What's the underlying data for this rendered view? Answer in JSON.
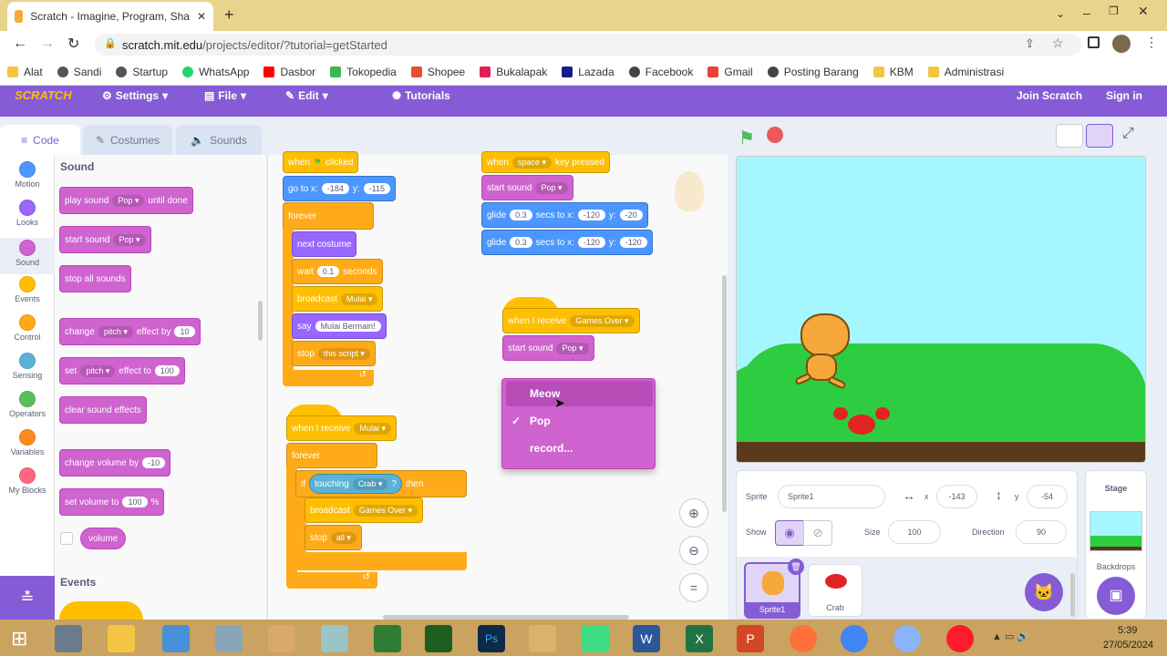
{
  "browser": {
    "tab_title": "Scratch - Imagine, Program, Sha",
    "url_domain": "scratch.mit.edu",
    "url_path": "/projects/editor/?tutorial=getStarted",
    "bookmarks": [
      "Alat",
      "Sandi",
      "Startup",
      "WhatsApp",
      "Dasbor",
      "Tokopedia",
      "Shopee",
      "Bukalapak",
      "Lazada",
      "Facebook",
      "Gmail",
      "Posting Barang",
      "KBM",
      "Administrasi"
    ]
  },
  "menubar": {
    "logo": "SCRATCH",
    "settings": "Settings",
    "file": "File",
    "edit": "Edit",
    "tutorials": "Tutorials",
    "join": "Join Scratch",
    "signin": "Sign in"
  },
  "tabs": {
    "code": "Code",
    "costumes": "Costumes",
    "sounds": "Sounds"
  },
  "categories": [
    {
      "label": "Motion",
      "color": "#4c97ff"
    },
    {
      "label": "Looks",
      "color": "#9966ff"
    },
    {
      "label": "Sound",
      "color": "#cf63cf"
    },
    {
      "label": "Events",
      "color": "#ffbf00"
    },
    {
      "label": "Control",
      "color": "#ffab19"
    },
    {
      "label": "Sensing",
      "color": "#5cb1d6"
    },
    {
      "label": "Operators",
      "color": "#59c059"
    },
    {
      "label": "Variables",
      "color": "#ff8c1a"
    },
    {
      "label": "My Blocks",
      "color": "#ff6680"
    }
  ],
  "palette": {
    "heading": "Sound",
    "play_sound": "play sound",
    "pop": "Pop",
    "until_done": "until done",
    "start_sound": "start sound",
    "stop_all": "stop all sounds",
    "change": "change",
    "pitch": "pitch",
    "effect_by": "effect by",
    "val10": "10",
    "set": "set",
    "effect_to": "effect to",
    "val100": "100",
    "clear_effects": "clear sound effects",
    "change_volume": "change volume by",
    "val_neg10": "-10",
    "set_volume": "set volume to",
    "percent": "%",
    "volume": "volume",
    "events_heading": "Events"
  },
  "script1": {
    "when": "when",
    "clicked": "clicked",
    "goto": "go to x:",
    "x": "-184",
    "y_label": "y:",
    "y": "-115",
    "forever": "forever",
    "next_costume": "next costume",
    "wait": "wait",
    "wait_val": "0.1",
    "seconds": "seconds",
    "broadcast": "broadcast",
    "mulai": "Mulai",
    "say": "say",
    "say_text": "Mulai Bermain!",
    "stop": "stop",
    "this_script": "this script"
  },
  "script2": {
    "when": "when",
    "key": "space",
    "key_pressed": "key pressed",
    "start_sound": "start sound",
    "pop": "Pop",
    "glide": "glide",
    "secs": "0.3",
    "secs_to_x": "secs to x:",
    "x1": "-120",
    "y_label": "y:",
    "y1": "-20",
    "x2": "-120",
    "y2": "-120"
  },
  "script3": {
    "when_receive": "when I receive",
    "message": "Games Over",
    "start_sound": "start sound",
    "pop": "Pop"
  },
  "dropdown": {
    "items": [
      "Meow",
      "Pop",
      "record..."
    ],
    "checkmark": "✓"
  },
  "script4": {
    "when_receive": "when I receive",
    "message": "Mulai",
    "forever": "forever",
    "if": "if",
    "touching": "touching",
    "crab": "Crab",
    "q": "?",
    "then": "then",
    "broadcast": "broadcast",
    "games_over": "Games Over",
    "stop": "stop",
    "all": "all"
  },
  "zoom": {
    "reset": "="
  },
  "sprite_info": {
    "sprite_label": "Sprite",
    "sprite_name": "Sprite1",
    "x_label": "x",
    "x": "-143",
    "y_label": "y",
    "y": "-54",
    "show_label": "Show",
    "size_label": "Size",
    "size": "100",
    "direction_label": "Direction",
    "direction": "90"
  },
  "sprites": [
    {
      "name": "Sprite1"
    },
    {
      "name": "Crab"
    }
  ],
  "stage_panel": {
    "title": "Stage",
    "backdrops": "Backdrops"
  },
  "taskbar": {
    "time": "5:39",
    "date": "27/05/2024"
  },
  "colors": {
    "menubar": "#855cd6",
    "stage_sky": "#a6f6ff",
    "ground": "#5a3a1a",
    "hills": "#2ecc40"
  }
}
